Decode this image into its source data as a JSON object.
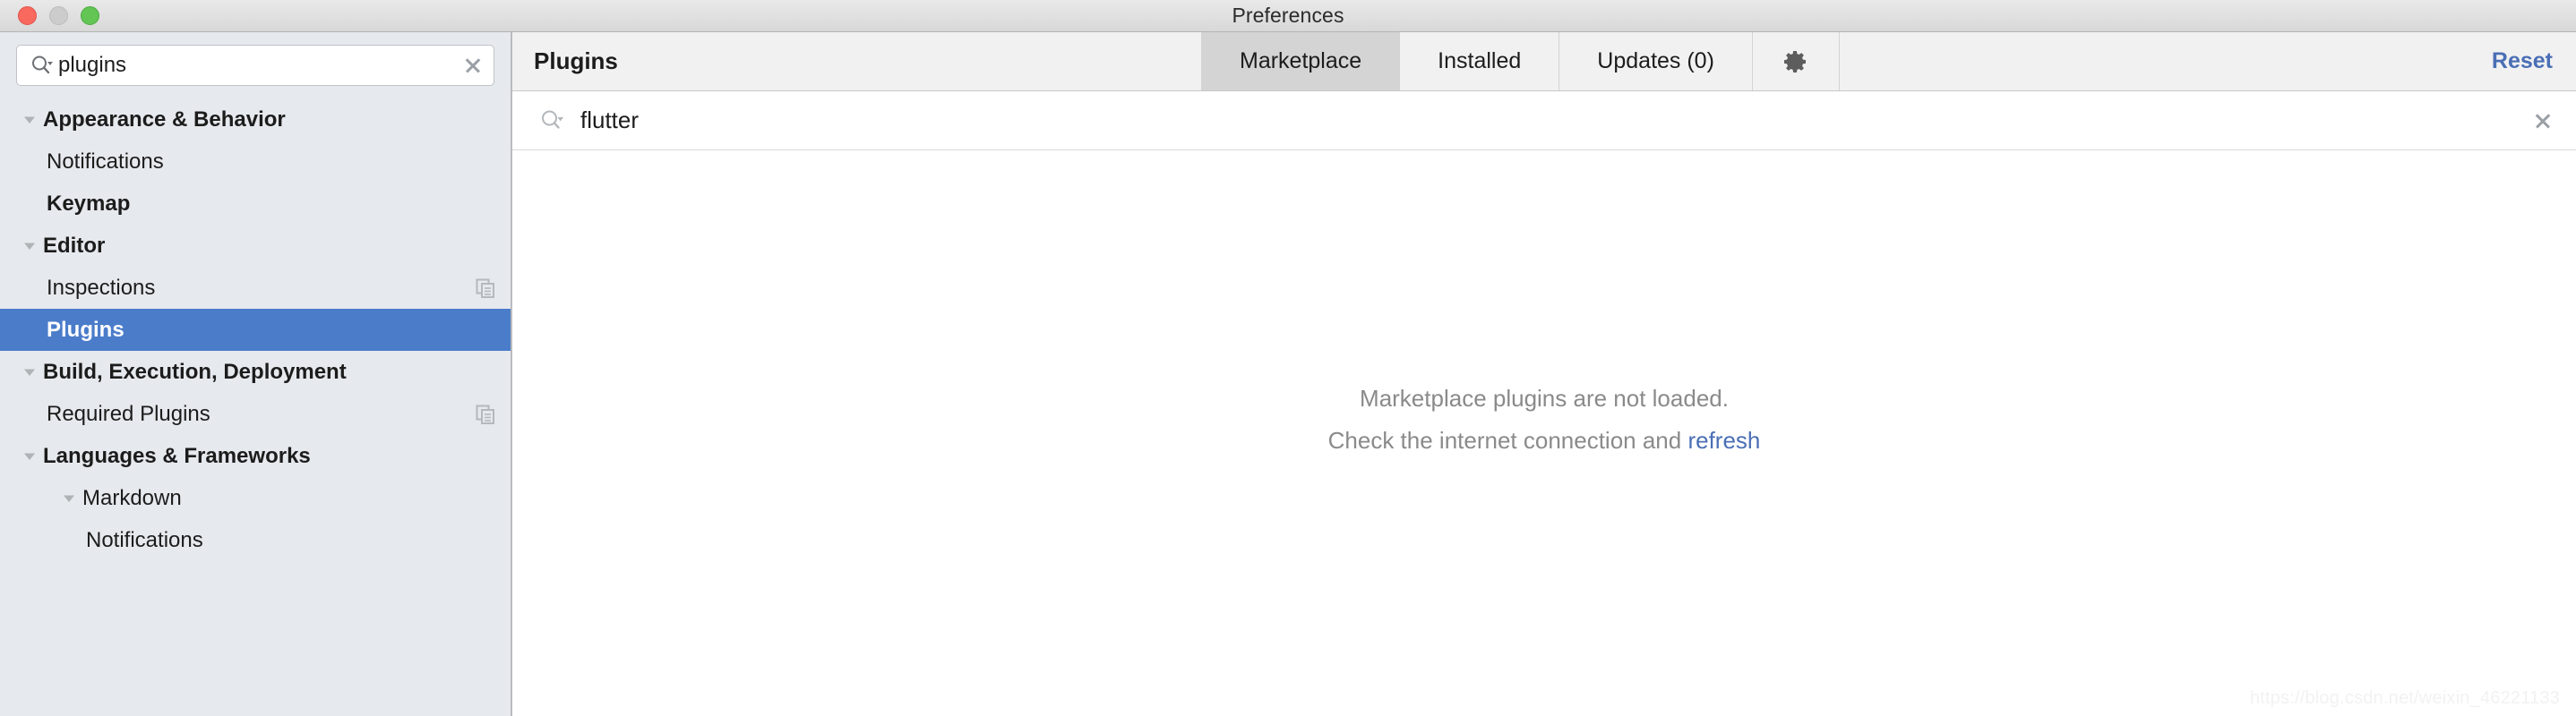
{
  "window": {
    "title": "Preferences",
    "traffic_lights": [
      "close-button",
      "minimize-button",
      "maximize-button"
    ]
  },
  "sidebar": {
    "search": {
      "value": "plugins",
      "placeholder": "",
      "icon": "search-icon",
      "clear_icon": "clear-icon"
    },
    "items": [
      {
        "label": "Appearance & Behavior",
        "level": 0,
        "bold": true,
        "expanded": true,
        "selected": false,
        "icon": null
      },
      {
        "label": "Notifications",
        "level": 1,
        "bold": false,
        "expanded": null,
        "selected": false,
        "icon": null
      },
      {
        "label": "Keymap",
        "level": 0,
        "bold": true,
        "expanded": null,
        "selected": false,
        "icon": null
      },
      {
        "label": "Editor",
        "level": 0,
        "bold": true,
        "expanded": true,
        "selected": false,
        "icon": null
      },
      {
        "label": "Inspections",
        "level": 1,
        "bold": false,
        "expanded": null,
        "selected": false,
        "icon": "copy-icon"
      },
      {
        "label": "Plugins",
        "level": 1,
        "bold": true,
        "expanded": null,
        "selected": true,
        "icon": null
      },
      {
        "label": "Build, Execution, Deployment",
        "level": 0,
        "bold": true,
        "expanded": true,
        "selected": false,
        "icon": null
      },
      {
        "label": "Required Plugins",
        "level": 1,
        "bold": false,
        "expanded": null,
        "selected": false,
        "icon": "copy-icon"
      },
      {
        "label": "Languages & Frameworks",
        "level": 0,
        "bold": true,
        "expanded": true,
        "selected": false,
        "icon": null
      },
      {
        "label": "Markdown",
        "level": 2,
        "bold": false,
        "expanded": true,
        "selected": false,
        "icon": null
      },
      {
        "label": "Notifications",
        "level": 3,
        "bold": false,
        "expanded": null,
        "selected": false,
        "icon": null
      }
    ]
  },
  "main": {
    "title": "Plugins",
    "tabs": [
      {
        "label": "Marketplace",
        "active": true
      },
      {
        "label": "Installed",
        "active": false
      },
      {
        "label": "Updates (0)",
        "active": false
      }
    ],
    "gear_icon": "gear-icon",
    "reset_label": "Reset",
    "plugin_search": {
      "value": "flutter",
      "placeholder": "",
      "icon": "search-icon",
      "clear_icon": "clear-icon"
    },
    "empty_state": {
      "line1": "Marketplace plugins are not loaded.",
      "line2_prefix": "Check the internet connection and ",
      "line2_link": "refresh"
    }
  },
  "watermark": "https://blog.csdn.net/weixin_46221133",
  "colors": {
    "selection_blue": "#4a7cca",
    "link_blue": "#4a6fb5",
    "sidebar_bg": "#e6e9ed",
    "header_bg": "#f1f1f1",
    "active_tab_bg": "#d4d4d4",
    "muted_text": "#8a8a8a"
  }
}
